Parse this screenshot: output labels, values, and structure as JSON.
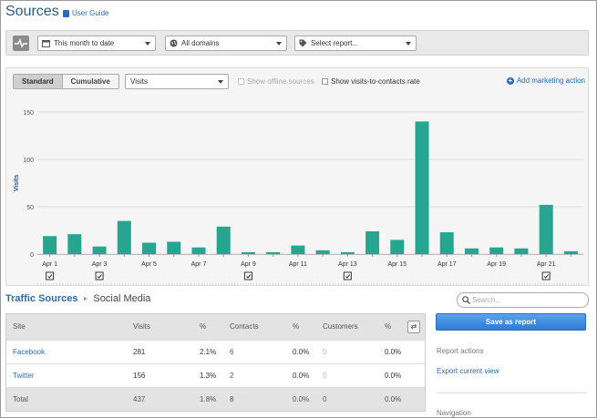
{
  "header": {
    "title": "Sources",
    "user_guide": "User Guide"
  },
  "filters": {
    "date_range": "This month to date",
    "domains": "All domains",
    "report": "Select report..."
  },
  "chart_controls": {
    "standard": "Standard",
    "cumulative": "Cumulative",
    "metric": "Visits",
    "show_offline": "Show offline sources",
    "show_rate": "Show visits-to-contacts rate",
    "add_marketing": "Add marketing action"
  },
  "colors": {
    "bar": "#26a590",
    "link": "#2a6bb8",
    "title": "#2a5b8c",
    "button": "#3a86dd"
  },
  "chart_data": {
    "type": "bar",
    "ylabel": "Visits",
    "ylim": [
      0,
      150
    ],
    "yticks": [
      0,
      50,
      100,
      150
    ],
    "categories": [
      "Apr 1",
      "Apr 2",
      "Apr 3",
      "Apr 4",
      "Apr 5",
      "Apr 6",
      "Apr 7",
      "Apr 8",
      "Apr 9",
      "Apr 10",
      "Apr 11",
      "Apr 12",
      "Apr 13",
      "Apr 14",
      "Apr 15",
      "Apr 16",
      "Apr 17",
      "Apr 18",
      "Apr 19",
      "Apr 20",
      "Apr 21",
      "Apr 22"
    ],
    "xtick_labels": [
      "Apr 1",
      "",
      "Apr 3",
      "",
      "Apr 5",
      "",
      "Apr 7",
      "",
      "Apr 9",
      "",
      "Apr 11",
      "",
      "Apr 13",
      "",
      "Apr 15",
      "",
      "Apr 17",
      "",
      "Apr 19",
      "",
      "Apr 21",
      ""
    ],
    "values": [
      19,
      21,
      8,
      35,
      12,
      13,
      7,
      29,
      2,
      2,
      9,
      4,
      2,
      24,
      15,
      140,
      23,
      6,
      7,
      6,
      52,
      3
    ],
    "marker_days": [
      "Apr 1",
      "Apr 3",
      "Apr 9",
      "Apr 13",
      "Apr 21"
    ],
    "grid": true
  },
  "traffic": {
    "crumb_link": "Traffic Sources",
    "crumb_current": "Social Media",
    "columns": [
      "Site",
      "Visits",
      "%",
      "Contacts",
      "%",
      "Customers",
      "%"
    ],
    "rows": [
      {
        "site": "Facebook",
        "visits": "281",
        "visits_pct": "2.1%",
        "contacts": "6",
        "contacts_pct": "0.0%",
        "customers": "0",
        "customers_pct": "0.0%"
      },
      {
        "site": "Twitter",
        "visits": "156",
        "visits_pct": "1.3%",
        "contacts": "2",
        "contacts_pct": "0.0%",
        "customers": "0",
        "customers_pct": "0.0%"
      }
    ],
    "total": {
      "site": "Total",
      "visits": "437",
      "visits_pct": "1.8%",
      "contacts": "8",
      "contacts_pct": "0.0%",
      "customers": "0",
      "customers_pct": "0.0%"
    },
    "swap_icon": "swap-icon"
  },
  "sidebar": {
    "search_placeholder": "Search...",
    "save_button": "Save as report",
    "report_actions": "Report actions",
    "export": "Export current view",
    "navigation": "Navigation"
  }
}
